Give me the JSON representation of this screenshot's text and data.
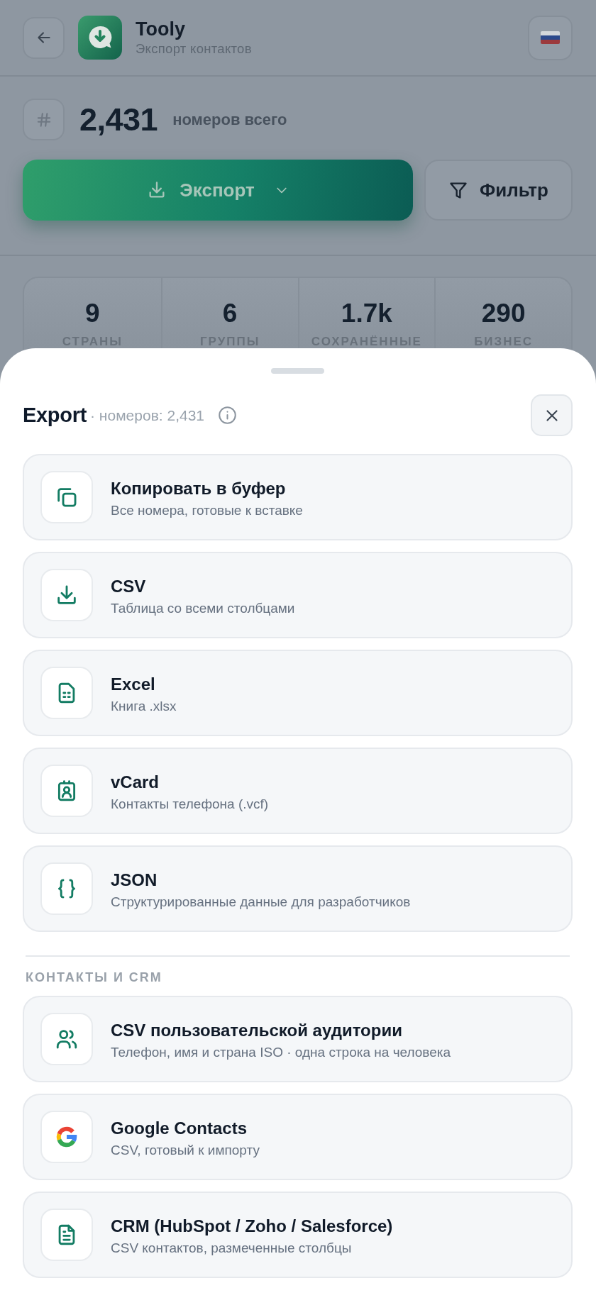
{
  "header": {
    "title": "Tooly",
    "subtitle": "Экспорт контактов"
  },
  "summary": {
    "count": "2,431",
    "label": "номеров всего"
  },
  "actions": [
    {
      "kind": "export",
      "label": "Экспорт"
    },
    {
      "kind": "filter",
      "label": "Фильтр"
    }
  ],
  "stats": [
    {
      "value": "9",
      "label": "СТРАНЫ"
    },
    {
      "value": "6",
      "label": "ГРУППЫ"
    },
    {
      "value": "1.7k",
      "label": "СОХРАНЁННЫЕ"
    },
    {
      "value": "290",
      "label": "БИЗНЕС"
    }
  ],
  "sheet": {
    "title": "Export",
    "subtitle": "· номеров: 2,431",
    "groups": [
      {
        "options": [
          {
            "kind": "copy",
            "title": "Копировать в буфер",
            "description": "Все номера, готовые к вставке"
          },
          {
            "kind": "download",
            "title": "CSV",
            "description": "Таблица со всеми столбцами"
          },
          {
            "kind": "spreadsheet",
            "title": "Excel",
            "description": "Книга .xlsx"
          },
          {
            "kind": "vcard",
            "title": "vCard",
            "description": "Контакты телефона (.vcf)"
          },
          {
            "kind": "code",
            "title": "JSON",
            "description": "Структурированные данные для разработчиков"
          }
        ]
      },
      {
        "heading": "КОНТАКТЫ И CRM",
        "options": [
          {
            "kind": "people",
            "title": "CSV пользовательской аудитории",
            "description": "Телефон, имя и страна ISO · одна строка на человека"
          },
          {
            "kind": "google",
            "title": "Google Contacts",
            "description": "CSV, готовый к импорту"
          },
          {
            "kind": "document",
            "title": "CRM (HubSpot / Zoho / Salesforce)",
            "description": "CSV контактов, размеченные столбцы"
          }
        ]
      }
    ]
  }
}
